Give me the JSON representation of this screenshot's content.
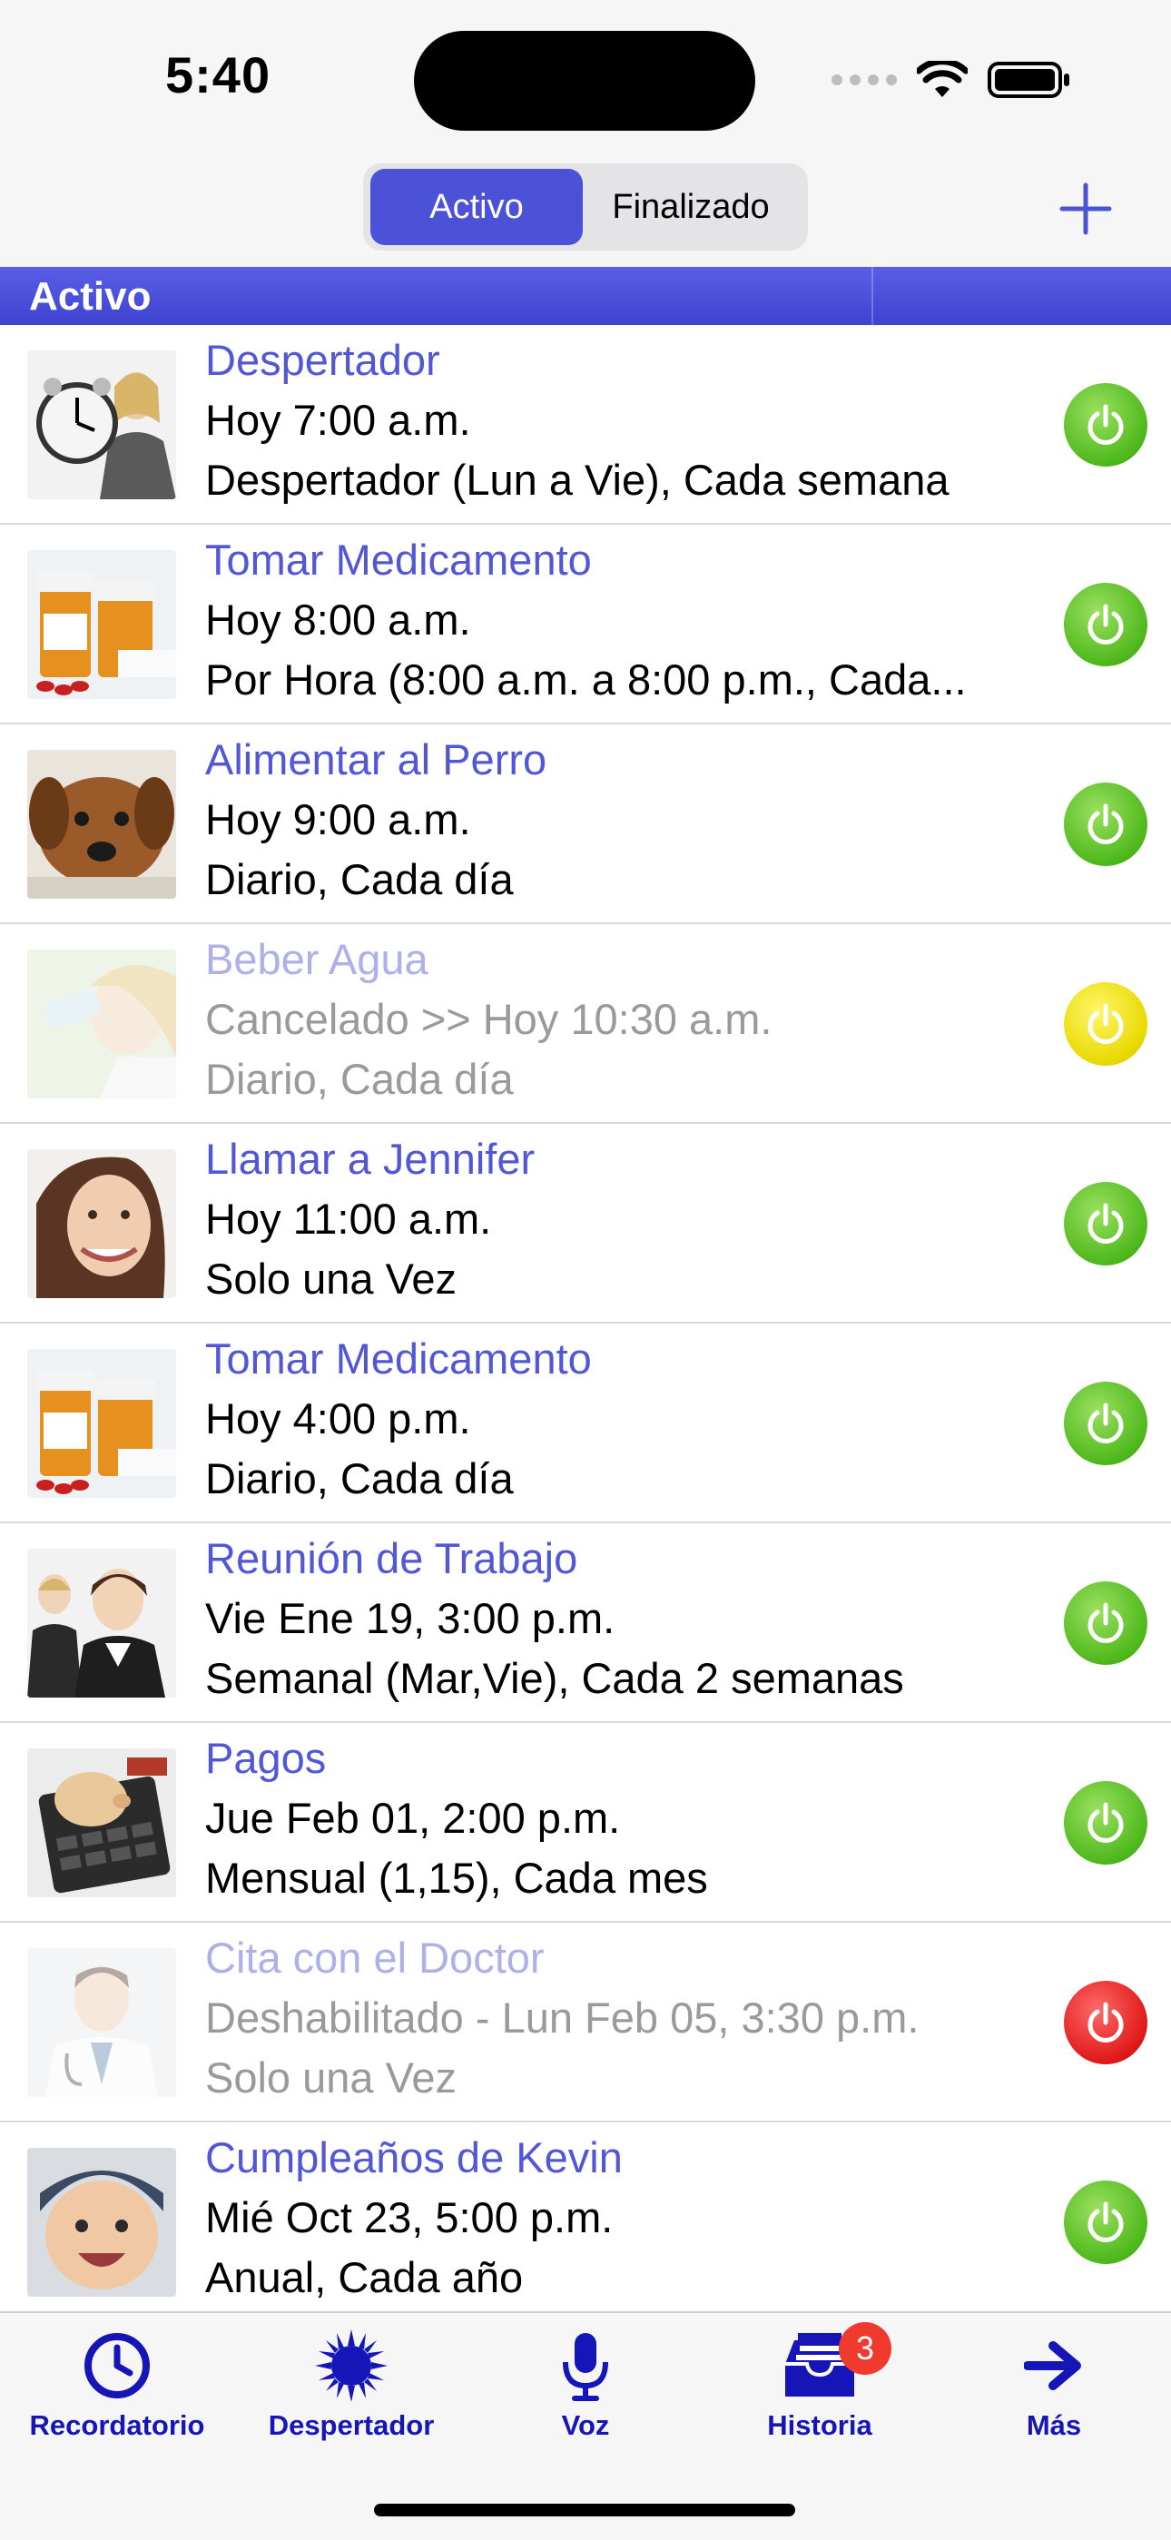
{
  "status_bar": {
    "time": "5:40"
  },
  "segmented": {
    "active_label": "Activo",
    "inactive_label": "Finalizado"
  },
  "section": {
    "title": "Activo"
  },
  "reminders": [
    {
      "title": "Despertador",
      "line1": "Hoy 7:00 a.m.",
      "line2": "Despertador (Lun a Vie), Cada semana",
      "status": "green",
      "image": "woman-with-clock"
    },
    {
      "title": "Tomar Medicamento",
      "line1": "Hoy 8:00 a.m.",
      "line2": "Por Hora (8:00 a.m. a 8:00 p.m., Cada...",
      "status": "green",
      "image": "pill-bottles"
    },
    {
      "title": "Alimentar al Perro",
      "line1": "Hoy 9:00 a.m.",
      "line2": "Diario, Cada día",
      "status": "green",
      "image": "dog"
    },
    {
      "title": "Beber Agua",
      "line1": "Cancelado >> Hoy 10:30 a.m.",
      "line2": "Diario, Cada día",
      "status": "yellow",
      "image": "woman-drinking-water"
    },
    {
      "title": "Llamar a Jennifer",
      "line1": "Hoy 11:00 a.m.",
      "line2": "Solo una Vez",
      "status": "green",
      "image": "smiling-woman"
    },
    {
      "title": "Tomar Medicamento",
      "line1": "Hoy 4:00 p.m.",
      "line2": "Diario, Cada día",
      "status": "green",
      "image": "pill-bottles"
    },
    {
      "title": "Reunión de Trabajo",
      "line1": "Vie Ene 19, 3:00 p.m.",
      "line2": "Semanal (Mar,Vie), Cada 2 semanas",
      "status": "green",
      "image": "business-team"
    },
    {
      "title": "Pagos",
      "line1": "Jue Feb 01, 2:00 p.m.",
      "line2": "Mensual (1,15), Cada mes",
      "status": "green",
      "image": "piggy-bank-calculator"
    },
    {
      "title": "Cita con el Doctor",
      "line1": "Deshabilitado - Lun Feb 05, 3:30 p.m.",
      "line2": "Solo una Vez",
      "status": "red",
      "image": "doctor"
    },
    {
      "title": "Cumpleaños de Kevin",
      "line1": "Mié Oct 23, 5:00 p.m.",
      "line2": "Anual, Cada año",
      "status": "green",
      "image": "baby"
    }
  ],
  "tabs": [
    {
      "label": "Recordatorio",
      "icon": "clock-icon"
    },
    {
      "label": "Despertador",
      "icon": "sun-icon"
    },
    {
      "label": "Voz",
      "icon": "microphone-icon"
    },
    {
      "label": "Historia",
      "icon": "inbox-icon",
      "badge": "3"
    },
    {
      "label": "Más",
      "icon": "arrow-right-icon"
    }
  ],
  "colors": {
    "accent": "#4c52d8",
    "tab_tint": "#1515b8",
    "green": "#4eb81c",
    "yellow": "#e8d900",
    "red": "#e01818"
  }
}
